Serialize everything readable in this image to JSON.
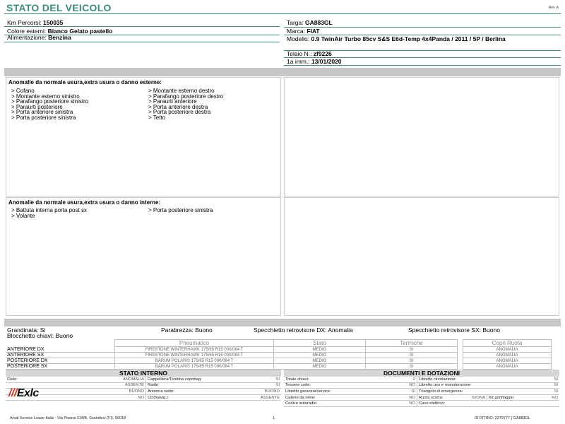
{
  "header": {
    "title": "STATO DEL VEICOLO",
    "rev": "Rev. A"
  },
  "vehicle_left": [
    {
      "label": "Km Percorsi: ",
      "value": "150035"
    },
    {
      "label": "Colore esterni: ",
      "value": "Bianco Gelato pastello"
    },
    {
      "label": "Alimentazione: ",
      "value": "Benzina"
    }
  ],
  "vehicle_right": {
    "targa": {
      "label": "Targa: ",
      "value": "GA883GL"
    },
    "marca": {
      "label": "Marca: ",
      "value": "FIAT"
    },
    "modello": {
      "label": "Modello: ",
      "value": "0.9 TwinAir Turbo 85cv S&S E6d-Temp 4x4Panda / 2011 / 5P / Berlina"
    },
    "telaio": {
      "label": "Telaio N.: ",
      "value": "zf9226"
    },
    "imm": {
      "label": "1a imm.: ",
      "value": "13/01/2020"
    }
  },
  "external_damage": {
    "title": "Anomalie da normale usura,extra usura o danno esterne:",
    "col1": [
      "> Cofano",
      "> Montante esterno sinistro",
      "> Parafango posteriore sinistro",
      "> Paraurti posteriore",
      "> Porta anteriore sinistra",
      "> Porta posteriore sinistra"
    ],
    "col2": [
      "> Montante esterno destro",
      "> Parafango posteriore destro",
      "> Paraurti anteriore",
      "> Porta anteriore destra",
      "> Porta posteriore destra",
      "> Tetto"
    ]
  },
  "internal_damage": {
    "title": "Anomalie da normale usura,extra usura o danno interne:",
    "col1": [
      "> Battuta interna porta post sx",
      "> Volante"
    ],
    "col2": [
      "> Porta posteriore sinistra"
    ]
  },
  "conditions": {
    "grandinata": "Grandinata: Si",
    "parabrezza": "Parabrezza: Buono",
    "specchietto_dx": "Specchietto retrovisore DX: Anomalia",
    "specchietto_sx": "Specchietto retrovisore SX: Buono",
    "blocchetto": "Blocchetto chiavi: Buono"
  },
  "tyres": {
    "headers": [
      "Pneumatico",
      "Stato",
      "Termiche",
      "Copri Ruota"
    ],
    "rows": [
      {
        "pos": "ANTERIORE DX",
        "tyre": "FIRESTONE WINTERHAWK  175/65 R15 000/084 T",
        "stato": "MEDIO",
        "termiche": "SI",
        "copri": "ANOMALIA"
      },
      {
        "pos": "ANTERIORE SX",
        "tyre": "FIRESTONE WINTERHAWK  175/65 R15 000/084 T",
        "stato": "MEDIO",
        "termiche": "SI",
        "copri": "ANOMALIA"
      },
      {
        "pos": "POSTERIORE DX",
        "tyre": "BARUM POLARIS  175/65 R15 000/084 T",
        "stato": "MEDIO",
        "termiche": "SI",
        "copri": "ANOMALIA"
      },
      {
        "pos": "POSTERIORE SX",
        "tyre": "BARUM POLARIS  175/65 R15 000/084 T",
        "stato": "MEDIO",
        "termiche": "SI",
        "copri": "ANOMALIA"
      }
    ]
  },
  "stato_interno": {
    "title": "STATO INTERNO",
    "rows": [
      {
        "l1": "Cielo:",
        "v1": "ANOMALIA",
        "l2": "Cappelliera/Tendina copribag:",
        "v2": "SI"
      },
      {
        "l1": "",
        "v1": "ASSENTE",
        "l2": "Radio:",
        "v2": "SI"
      },
      {
        "l1": "",
        "v1": "BUONO",
        "l2": "Antenna radio:",
        "v2": "BUONO"
      },
      {
        "l1": "",
        "v1": "NO",
        "l2": "CD(Navig.):",
        "v2": "ASSENTE"
      }
    ]
  },
  "documenti": {
    "title": "DOCUMENTI E DOTAZIONI",
    "rows": [
      {
        "l1": "Totale chiavi:",
        "v1": "2",
        "l2": "Libretto circolazione:",
        "v2": "SI",
        "l3": "",
        "v3": ""
      },
      {
        "l1": "Tessere code:",
        "v1": "NO",
        "l2": "Libretto uso e manutenzione:",
        "v2": "SI",
        "l3": "",
        "v3": ""
      },
      {
        "l1": "Libretto garanzia/service:",
        "v1": "SI",
        "l2": "Triangolo di emergenza:",
        "v2": "SI",
        "l3": "",
        "v3": ""
      },
      {
        "l1": "Catene da neve:",
        "v1": "NO",
        "l2": "Ruota scorta:",
        "v2": "SI/ONA",
        "l3": "Kit gonfiaggio:",
        "v3": "NO"
      },
      {
        "l1": "Codice autoradio:",
        "v1": "NO",
        "l2": "Cavo elettrico:",
        "v2": "",
        "l3": "",
        "v3": ""
      }
    ]
  },
  "logo": {
    "prefix": "///",
    "text": "Exlc"
  },
  "footer": {
    "company": "Arval Service Lease Italia - Via Pisana 314/B, Scandicci (FI), 50018",
    "page": "1",
    "id": "ID RITIRO: 2279777 | GA883GL"
  }
}
